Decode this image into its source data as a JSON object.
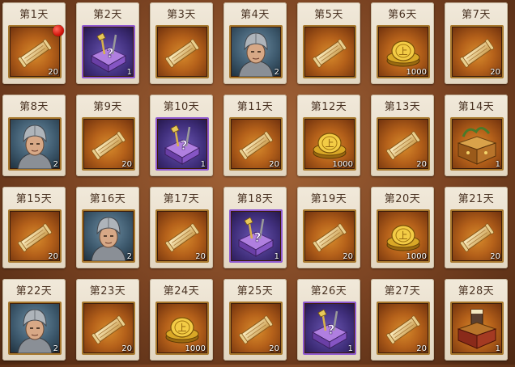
{
  "days": [
    {
      "label": "第1天",
      "item": "scroll",
      "qty": "20",
      "badge": true
    },
    {
      "label": "第2天",
      "item": "chest",
      "qty": "1"
    },
    {
      "label": "第3天",
      "item": "scroll",
      "qty": ""
    },
    {
      "label": "第4天",
      "item": "hero",
      "qty": "2"
    },
    {
      "label": "第5天",
      "item": "scroll",
      "qty": ""
    },
    {
      "label": "第6天",
      "item": "coin",
      "qty": "1000"
    },
    {
      "label": "第7天",
      "item": "scroll",
      "qty": "20"
    },
    {
      "label": "第8天",
      "item": "hero",
      "qty": "2"
    },
    {
      "label": "第9天",
      "item": "scroll",
      "qty": "20"
    },
    {
      "label": "第10天",
      "item": "chest",
      "qty": "1"
    },
    {
      "label": "第11天",
      "item": "scroll",
      "qty": "20"
    },
    {
      "label": "第12天",
      "item": "coin",
      "qty": "1000"
    },
    {
      "label": "第13天",
      "item": "scroll",
      "qty": "20"
    },
    {
      "label": "第14天",
      "item": "box",
      "qty": "1"
    },
    {
      "label": "第15天",
      "item": "scroll",
      "qty": "20"
    },
    {
      "label": "第16天",
      "item": "hero",
      "qty": "2"
    },
    {
      "label": "第17天",
      "item": "scroll",
      "qty": "20"
    },
    {
      "label": "第18天",
      "item": "chest",
      "qty": "1"
    },
    {
      "label": "第19天",
      "item": "scroll",
      "qty": "20"
    },
    {
      "label": "第20天",
      "item": "coin",
      "qty": "1000"
    },
    {
      "label": "第21天",
      "item": "scroll",
      "qty": "20"
    },
    {
      "label": "第22天",
      "item": "hero",
      "qty": "2"
    },
    {
      "label": "第23天",
      "item": "scroll",
      "qty": "20"
    },
    {
      "label": "第24天",
      "item": "coin",
      "qty": "1000"
    },
    {
      "label": "第25天",
      "item": "scroll",
      "qty": "20"
    },
    {
      "label": "第26天",
      "item": "chest",
      "qty": "1"
    },
    {
      "label": "第27天",
      "item": "scroll",
      "qty": "20"
    },
    {
      "label": "第28天",
      "item": "box2",
      "qty": "1"
    }
  ]
}
